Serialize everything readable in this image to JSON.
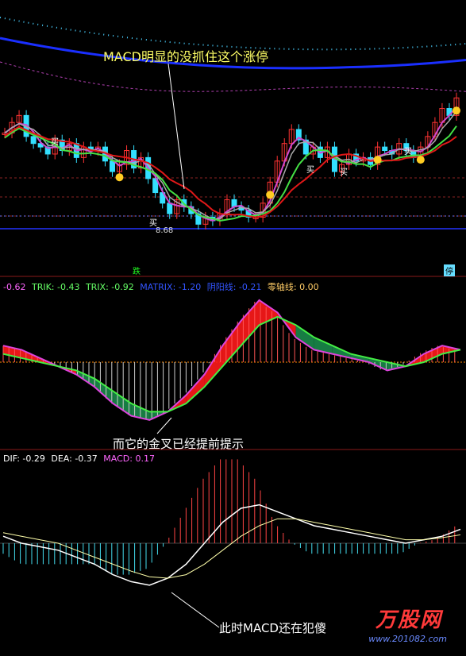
{
  "colors": {
    "bg": "#000000",
    "grid": "#8a1a1a",
    "candle_up": "#ff3333",
    "candle_down": "#33e0ff",
    "ma_blue": "#1a2fff",
    "ma_red": "#e01818",
    "ma_green": "#44e044",
    "ma_magenta": "#d04ad0",
    "ma_gray": "#aaaaaa",
    "dotted_cyan": "#4ad0ff",
    "dashed_magenta": "#b040b0",
    "white": "#ffffff",
    "yellow": "#ffff66"
  },
  "annotations": {
    "top": "MACD明显的没抓住这个涨停",
    "middle": "而它的金叉已经提前提示",
    "bottom": "此时MACD还在犯傻"
  },
  "buy_label": "买",
  "price_low_label": "8.68",
  "tag_die": "跌",
  "tag_ting": "停",
  "trix_legend": [
    {
      "text": "-0.62",
      "color": "#ff66ff"
    },
    {
      "text": "TRIK: -0.43",
      "color": "#66ff66"
    },
    {
      "text": "TRIX: -0.92",
      "color": "#66ff66"
    },
    {
      "text": "MATRIX: -1.20",
      "color": "#3355ff"
    },
    {
      "text": "阴阳线: -0.21",
      "color": "#3355ff"
    },
    {
      "text": "零轴线: 0.00",
      "color": "#ffcc66"
    }
  ],
  "macd_legend": [
    {
      "text": "DIF: -0.29",
      "color": "#ffffff"
    },
    {
      "text": "DEA: -0.37",
      "color": "#ffffff"
    },
    {
      "text": "MACD: 0.17",
      "color": "#ff66ff"
    }
  ],
  "watermark": {
    "brand": "万股网",
    "url": "www.201082.com"
  },
  "chart_data": [
    {
      "type": "candlestick",
      "panel": "price",
      "low_marker": 8.68,
      "close": [
        11.3,
        11.6,
        11.8,
        11.2,
        11.0,
        10.9,
        10.7,
        11.1,
        10.8,
        11.0,
        10.6,
        10.9,
        10.8,
        10.9,
        10.5,
        10.2,
        10.4,
        10.8,
        10.3,
        10.6,
        10.0,
        9.6,
        9.3,
        9.0,
        9.4,
        9.2,
        9.0,
        8.7,
        8.9,
        8.8,
        9.0,
        9.4,
        9.2,
        9.1,
        8.9,
        8.9,
        9.3,
        9.9,
        10.5,
        11.0,
        11.4,
        11.1,
        10.7,
        10.9,
        10.6,
        10.9,
        10.2,
        10.4,
        10.7,
        10.5,
        10.6,
        10.4,
        10.9,
        10.8,
        10.7,
        11.0,
        10.8,
        10.6,
        10.9,
        11.2,
        11.6,
        12.0,
        11.8,
        12.3
      ],
      "buy_signals": [
        16,
        35,
        52,
        55,
        60
      ],
      "marker_dots": [
        16,
        37,
        52,
        58,
        64
      ]
    },
    {
      "type": "line",
      "panel": "TRIX",
      "series": [
        {
          "name": "TRIK",
          "values": [
            0.4,
            0.3,
            0.1,
            -0.1,
            -0.3,
            -0.6,
            -1.0,
            -1.3,
            -1.4,
            -1.2,
            -0.8,
            -0.3,
            0.4,
            1.0,
            1.5,
            1.2,
            0.6,
            0.3,
            0.2,
            0.1,
            0.0,
            -0.2,
            -0.1,
            0.2,
            0.4,
            0.3
          ]
        },
        {
          "name": "TRIX",
          "values": [
            0.2,
            0.1,
            0.0,
            -0.1,
            -0.2,
            -0.4,
            -0.7,
            -1.0,
            -1.2,
            -1.2,
            -1.0,
            -0.6,
            -0.1,
            0.4,
            0.9,
            1.1,
            0.9,
            0.6,
            0.4,
            0.2,
            0.1,
            0.0,
            -0.1,
            0.0,
            0.2,
            0.3
          ]
        }
      ],
      "legend_values": {
        "TRIK": -0.43,
        "TRIX": -0.92,
        "MATRIX": -1.2,
        "阴阳线": -0.21,
        "零轴线": 0.0
      }
    },
    {
      "type": "line",
      "panel": "MACD",
      "series": [
        {
          "name": "DIF",
          "values": [
            0.1,
            0.0,
            -0.05,
            -0.1,
            -0.2,
            -0.3,
            -0.45,
            -0.55,
            -0.6,
            -0.5,
            -0.3,
            0.0,
            0.3,
            0.5,
            0.55,
            0.45,
            0.35,
            0.25,
            0.2,
            0.15,
            0.1,
            0.05,
            0.0,
            0.05,
            0.1,
            0.2
          ]
        },
        {
          "name": "DEA",
          "values": [
            0.15,
            0.1,
            0.05,
            0.0,
            -0.1,
            -0.2,
            -0.3,
            -0.4,
            -0.48,
            -0.5,
            -0.45,
            -0.3,
            -0.1,
            0.1,
            0.25,
            0.35,
            0.35,
            0.3,
            0.25,
            0.2,
            0.15,
            0.1,
            0.05,
            0.05,
            0.08,
            0.12
          ]
        }
      ],
      "legend_values": {
        "DIF": -0.29,
        "DEA": -0.37,
        "MACD": 0.17
      }
    }
  ]
}
